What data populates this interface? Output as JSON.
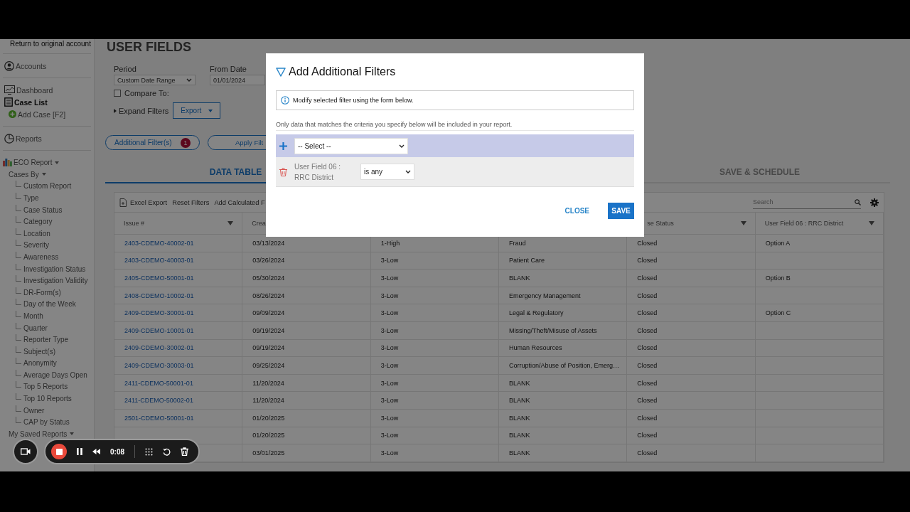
{
  "sidebar": {
    "top_link": "Return to original account",
    "nav": [
      {
        "label": "Accounts",
        "kind": "accounts",
        "selected": false
      },
      {
        "label": "Dashboard",
        "kind": "dashboard",
        "selected": false
      },
      {
        "label": "Case List",
        "kind": "list",
        "selected": true
      },
      {
        "label": "Add Case [F2]",
        "kind": "add",
        "selected": false
      },
      {
        "label": "Reports",
        "kind": "reports",
        "selected": false
      }
    ],
    "report_group": "ECO Report",
    "cases_by": "Cases By",
    "report_items": [
      "Custom Report",
      "Type",
      "Case Status",
      "Category",
      "Location",
      "Severity",
      "Awareness",
      "Investigation Status",
      "Investigation Validity",
      "DR-Form(s)",
      "Day of the Week",
      "Month",
      "Quarter",
      "Reporter Type",
      "Subject(s)",
      "Anonymity",
      "Average Days Open",
      "Top 5 Reports",
      "Top 10 Reports",
      "Owner",
      "CAP by Status"
    ],
    "saved_group": "My Saved Reports"
  },
  "page": {
    "title": "USER FIELDS",
    "period_label": "Period",
    "period_value": "Custom Date Range",
    "from_label": "From Date",
    "from_value": "01/01/2024",
    "compare_label": "Compare To:",
    "compare_checked": false,
    "expand_filters": "Expand Filters",
    "export": "Export",
    "additional_filters": "Additional Filter(s)",
    "filter_count": "1",
    "apply": "Apply Filt",
    "tabs": [
      {
        "label": "DATA TABLE",
        "selected": true
      },
      {
        "label": "SAVE & SCHEDULE",
        "selected": false
      }
    ]
  },
  "table": {
    "toolbar": [
      "Excel Export",
      "Reset Filters",
      "Add Calculated F"
    ],
    "search_placeholder": "Search",
    "columns": [
      {
        "label": "Issue #",
        "sort_icon": true
      },
      {
        "label": "Crea"
      },
      {},
      {},
      {
        "label": "se Status",
        "sort_icon": true
      },
      {
        "label": "User Field 06 : RRC District",
        "sort_icon": true
      }
    ],
    "rows": [
      {
        "issue": "2403-CDEMO-40002-01",
        "created": "03/13/2024",
        "priority": "1-High",
        "category": "Fraud",
        "status": "Closed",
        "district": "Option A"
      },
      {
        "issue": "2403-CDEMO-40003-01",
        "created": "03/26/2024",
        "priority": "3-Low",
        "category": "Patient Care",
        "status": "Closed"
      },
      {
        "issue": "2405-CDEMO-50001-01",
        "created": "05/30/2024",
        "priority": "3-Low",
        "category": "BLANK",
        "status": "Closed",
        "district": "Option B"
      },
      {
        "issue": "2408-CDEMO-10002-01",
        "created": "08/26/2024",
        "priority": "3-Low",
        "category": "Emergency Management",
        "status": "Closed"
      },
      {
        "issue": "2409-CDEMO-30001-01",
        "created": "09/09/2024",
        "priority": "3-Low",
        "category": "Legal & Regulatory",
        "status": "Closed",
        "district": "Option C"
      },
      {
        "issue": "2409-CDEMO-10001-01",
        "created": "09/19/2024",
        "priority": "3-Low",
        "category": "Missing/Theft/Misuse of Assets",
        "status": "Closed"
      },
      {
        "issue": "2409-CDEMO-30002-01",
        "created": "09/19/2024",
        "priority": "3-Low",
        "category": "Human Resources",
        "status": "Closed"
      },
      {
        "issue": "2409-CDEMO-30003-01",
        "created": "09/25/2024",
        "priority": "3-Low",
        "category": "Corruption/Abuse of Position, Emerg…",
        "status": "Closed"
      },
      {
        "issue": "2411-CDEMO-50001-01",
        "created": "11/20/2024",
        "priority": "3-Low",
        "category": "BLANK",
        "status": "Closed"
      },
      {
        "issue": "2411-CDEMO-50002-01",
        "created": "11/20/2024",
        "priority": "3-Low",
        "category": "BLANK",
        "status": "Closed"
      },
      {
        "issue": "2501-CDEMO-50001-01",
        "created": "01/20/2025",
        "priority": "3-Low",
        "category": "BLANK",
        "status": "Closed"
      },
      {
        "created": "01/20/2025",
        "priority": "3-Low",
        "category": "BLANK",
        "status": "Closed"
      },
      {
        "created": "03/01/2025",
        "priority": "3-Low",
        "category": "BLANK",
        "status": "Closed"
      }
    ]
  },
  "dialog": {
    "title": "Add Additional Filters",
    "info": "Modify selected filter using the form below.",
    "hint": "Only data that matches the criteria you specify below will be included in your report.",
    "add_select": "-- Select --",
    "filters": [
      {
        "field": "User Field 06 : RRC District",
        "operator": "is any"
      }
    ],
    "buttons": [
      {
        "label": "CLOSE",
        "kind": "text"
      },
      {
        "label": "SAVE",
        "kind": "primary"
      }
    ]
  },
  "recorder": {
    "time": "0:08"
  }
}
